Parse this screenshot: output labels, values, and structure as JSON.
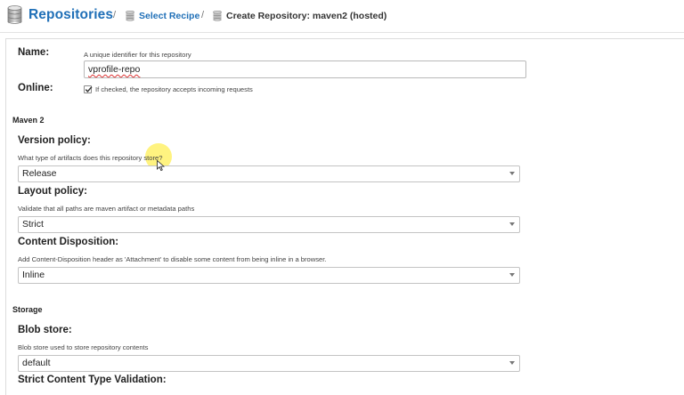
{
  "header": {
    "title": "Repositories",
    "breadcrumb": {
      "separator": "/",
      "link": "Select Recipe",
      "current": "Create Repository: maven2 (hosted)"
    }
  },
  "form": {
    "name": {
      "label": "Name:",
      "help": "A unique identifier for this repository",
      "value": "vprofile-repo"
    },
    "online": {
      "label": "Online:",
      "checked": true,
      "help": "If checked, the repository accepts incoming requests"
    },
    "maven_section": "Maven 2",
    "version_policy": {
      "label": "Version policy:",
      "help": "What type of artifacts does this repository store?",
      "value": "Release"
    },
    "layout_policy": {
      "label": "Layout policy:",
      "help": "Validate that all paths are maven artifact or metadata paths",
      "value": "Strict"
    },
    "content_disposition": {
      "label": "Content Disposition:",
      "help": "Add Content-Disposition header as 'Attachment' to disable some content from being inline in a browser.",
      "value": "Inline"
    },
    "storage_section": "Storage",
    "blob_store": {
      "label": "Blob store:",
      "help": "Blob store used to store repository contents",
      "value": "default"
    },
    "strict_content": {
      "label": "Strict Content Type Validation:"
    }
  },
  "icons": {
    "header": "database-icon",
    "breadcrumb": "database-icon",
    "cursor": "mouse-pointer-icon"
  },
  "colors": {
    "accent": "#1f6fb7",
    "cursor_highlight": "#ffec3c"
  }
}
